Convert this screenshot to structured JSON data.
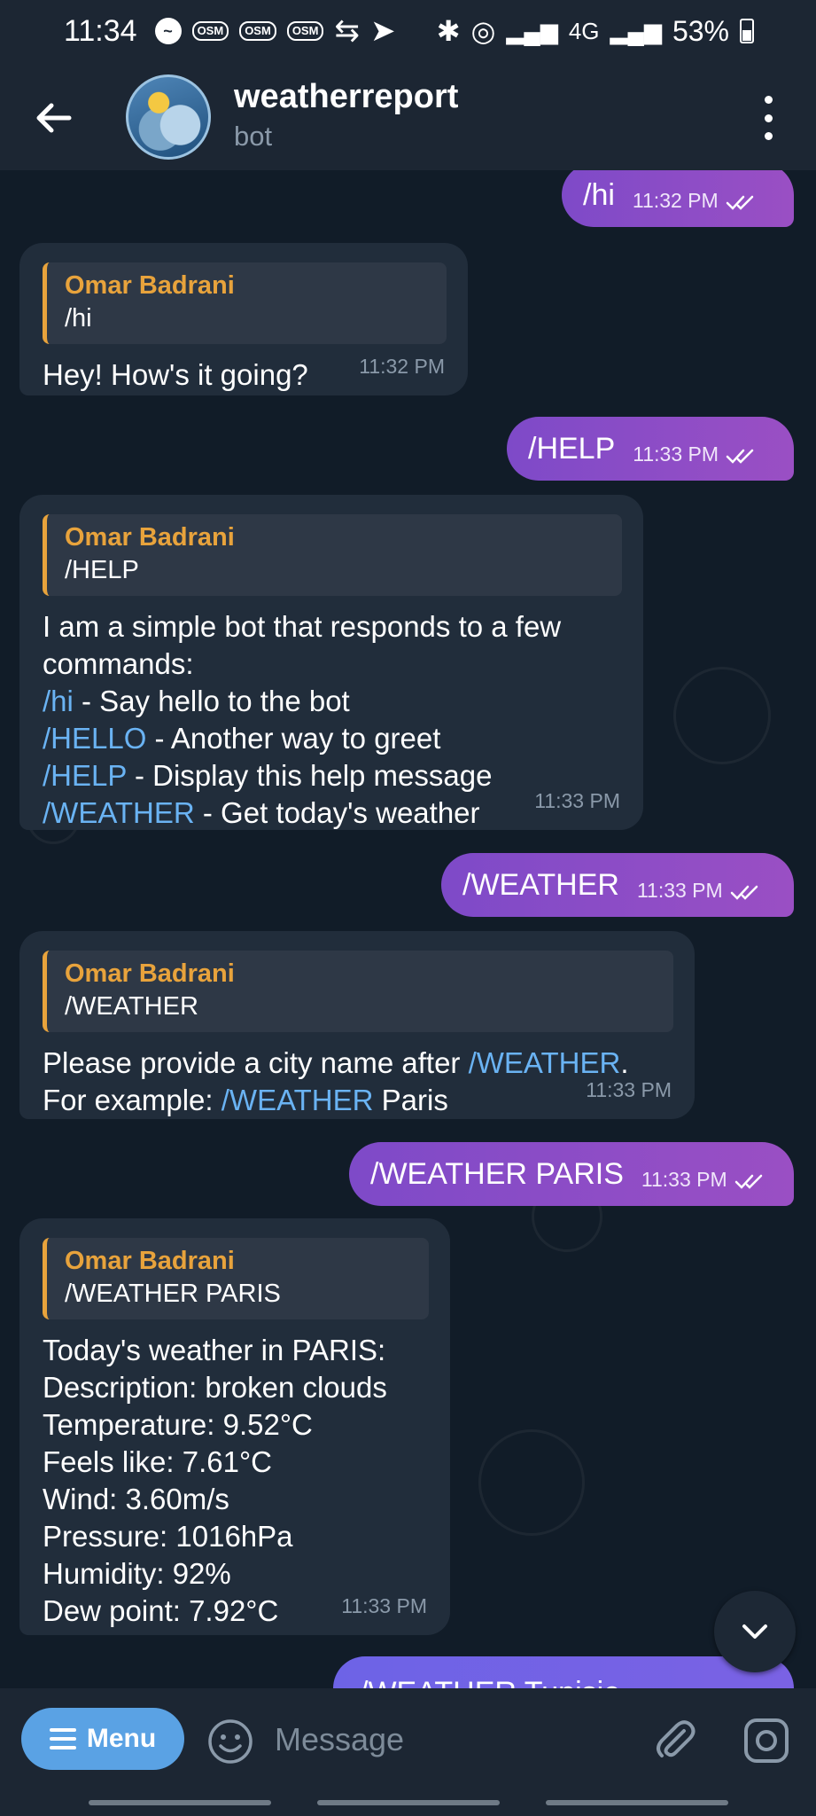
{
  "status_bar": {
    "time": "11:34",
    "osm_badges": [
      "OSM",
      "OSM",
      "OSM"
    ],
    "network": "4G",
    "battery": "53%"
  },
  "header": {
    "title": "weatherreport",
    "subtitle": "bot"
  },
  "messages": {
    "m1": {
      "text": "/hi",
      "time": "11:32 PM"
    },
    "m2": {
      "reply_name": "Omar Badrani",
      "reply_text": "/hi",
      "lines": [
        "Hey! How's it going?"
      ],
      "time": "11:32 PM"
    },
    "m3": {
      "text": "/HELP",
      "time": "11:33 PM"
    },
    "m4": {
      "reply_name": "Omar Badrani",
      "reply_text": "/HELP",
      "line1": "I am a simple bot that responds to a few",
      "line2": "commands:",
      "cmd1": "/hi",
      "desc1": " - Say hello to the bot",
      "cmd2": "/HELLO",
      "desc2": " - Another way to greet",
      "cmd3": "/HELP",
      "desc3": " - Display this help message",
      "cmd4": "/WEATHER",
      "desc4": " - Get today's weather",
      "time": "11:33 PM"
    },
    "m5": {
      "text": "/WEATHER",
      "time": "11:33 PM"
    },
    "m6": {
      "reply_name": "Omar Badrani",
      "reply_text": "/WEATHER",
      "line1_pre": "Please provide a city name after ",
      "line1_cmd": "/WEATHER",
      "line1_post": ".",
      "line2_pre": "For example: ",
      "line2_cmd": "/WEATHER",
      "line2_post": " Paris",
      "time": "11:33 PM"
    },
    "m7": {
      "text": "/WEATHER PARIS",
      "time": "11:33 PM"
    },
    "m8": {
      "reply_name": "Omar Badrani",
      "reply_text": "/WEATHER PARIS",
      "lines": [
        "Today's weather in PARIS:",
        "Description: broken clouds",
        "Temperature: 9.52°C",
        "Feels like: 7.61°C",
        "Wind: 3.60m/s",
        "Pressure: 1016hPa",
        "Humidity: 92%",
        "Dew point: 7.92°C"
      ],
      "time": "11:33 PM"
    },
    "m9_partial": {
      "text": "/WEATHER Tunisie"
    }
  },
  "input_bar": {
    "menu_label": "Menu",
    "placeholder": "Message"
  },
  "colors": {
    "outgoing_bubble": "#8e4ec6",
    "incoming_bubble": "#212d3b",
    "reply_accent": "#e8a33c",
    "command_link": "#6ab3f3",
    "menu_button": "#5aa2e4"
  },
  "icons": [
    "back-arrow-icon",
    "more-vert-icon",
    "double-check-icon",
    "chevron-down-icon",
    "hamburger-icon",
    "emoji-icon",
    "paperclip-icon",
    "camera-icon",
    "bluetooth-icon",
    "signal-icon"
  ]
}
